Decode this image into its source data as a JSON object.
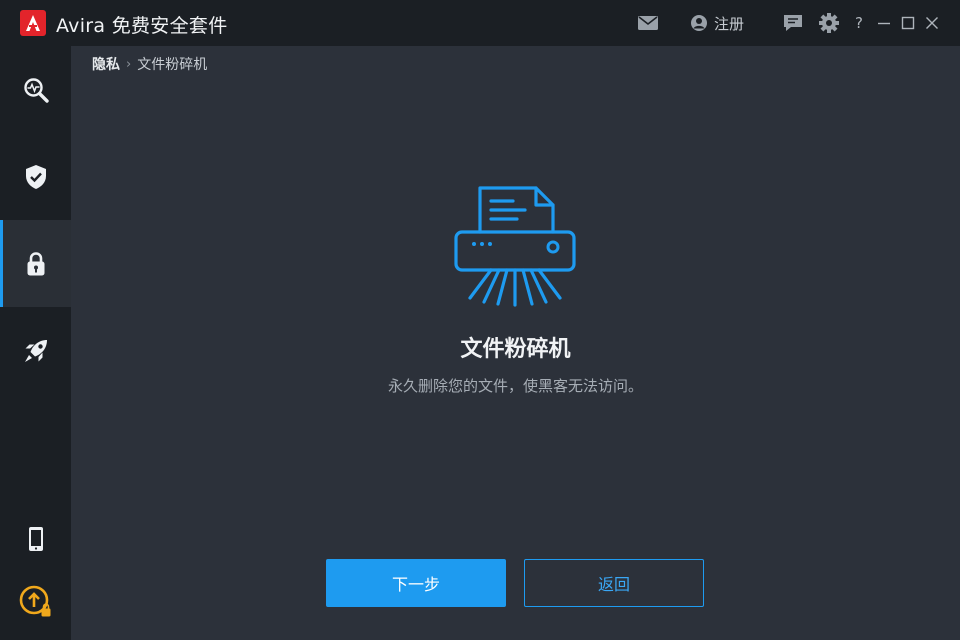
{
  "app": {
    "title": "Avira 免费安全套件",
    "logo_icon": "avira-logo-icon"
  },
  "titlebar": {
    "mail_icon": "mail-icon",
    "register_label": "注册",
    "chat_icon": "feedback-chat-icon",
    "settings_icon": "gear-icon",
    "help_label": "?",
    "minimize_icon": "minimize-icon",
    "maximize_icon": "maximize-icon",
    "close_icon": "close-icon"
  },
  "sidebar": {
    "items": [
      {
        "name": "scan",
        "icon": "search-pulse-icon",
        "active": false
      },
      {
        "name": "protection",
        "icon": "shield-check-icon",
        "active": false
      },
      {
        "name": "privacy",
        "icon": "lock-icon",
        "active": true
      },
      {
        "name": "performance",
        "icon": "rocket-icon",
        "active": false
      }
    ],
    "bottom_items": [
      {
        "name": "mobile",
        "icon": "phone-icon"
      },
      {
        "name": "upgrade",
        "icon": "upgrade-lock-icon"
      }
    ]
  },
  "breadcrumb": {
    "root": "隐私",
    "separator": "›",
    "current": "文件粉碎机"
  },
  "feature": {
    "icon": "shredder-icon",
    "title": "文件粉碎机",
    "description": "永久删除您的文件，使黑客无法访问。"
  },
  "buttons": {
    "next": "下一步",
    "back": "返回"
  },
  "colors": {
    "accent": "#1e9bf0",
    "brand": "#e3242b",
    "background": "#2c313a",
    "sidebar": "#1b1f24"
  }
}
